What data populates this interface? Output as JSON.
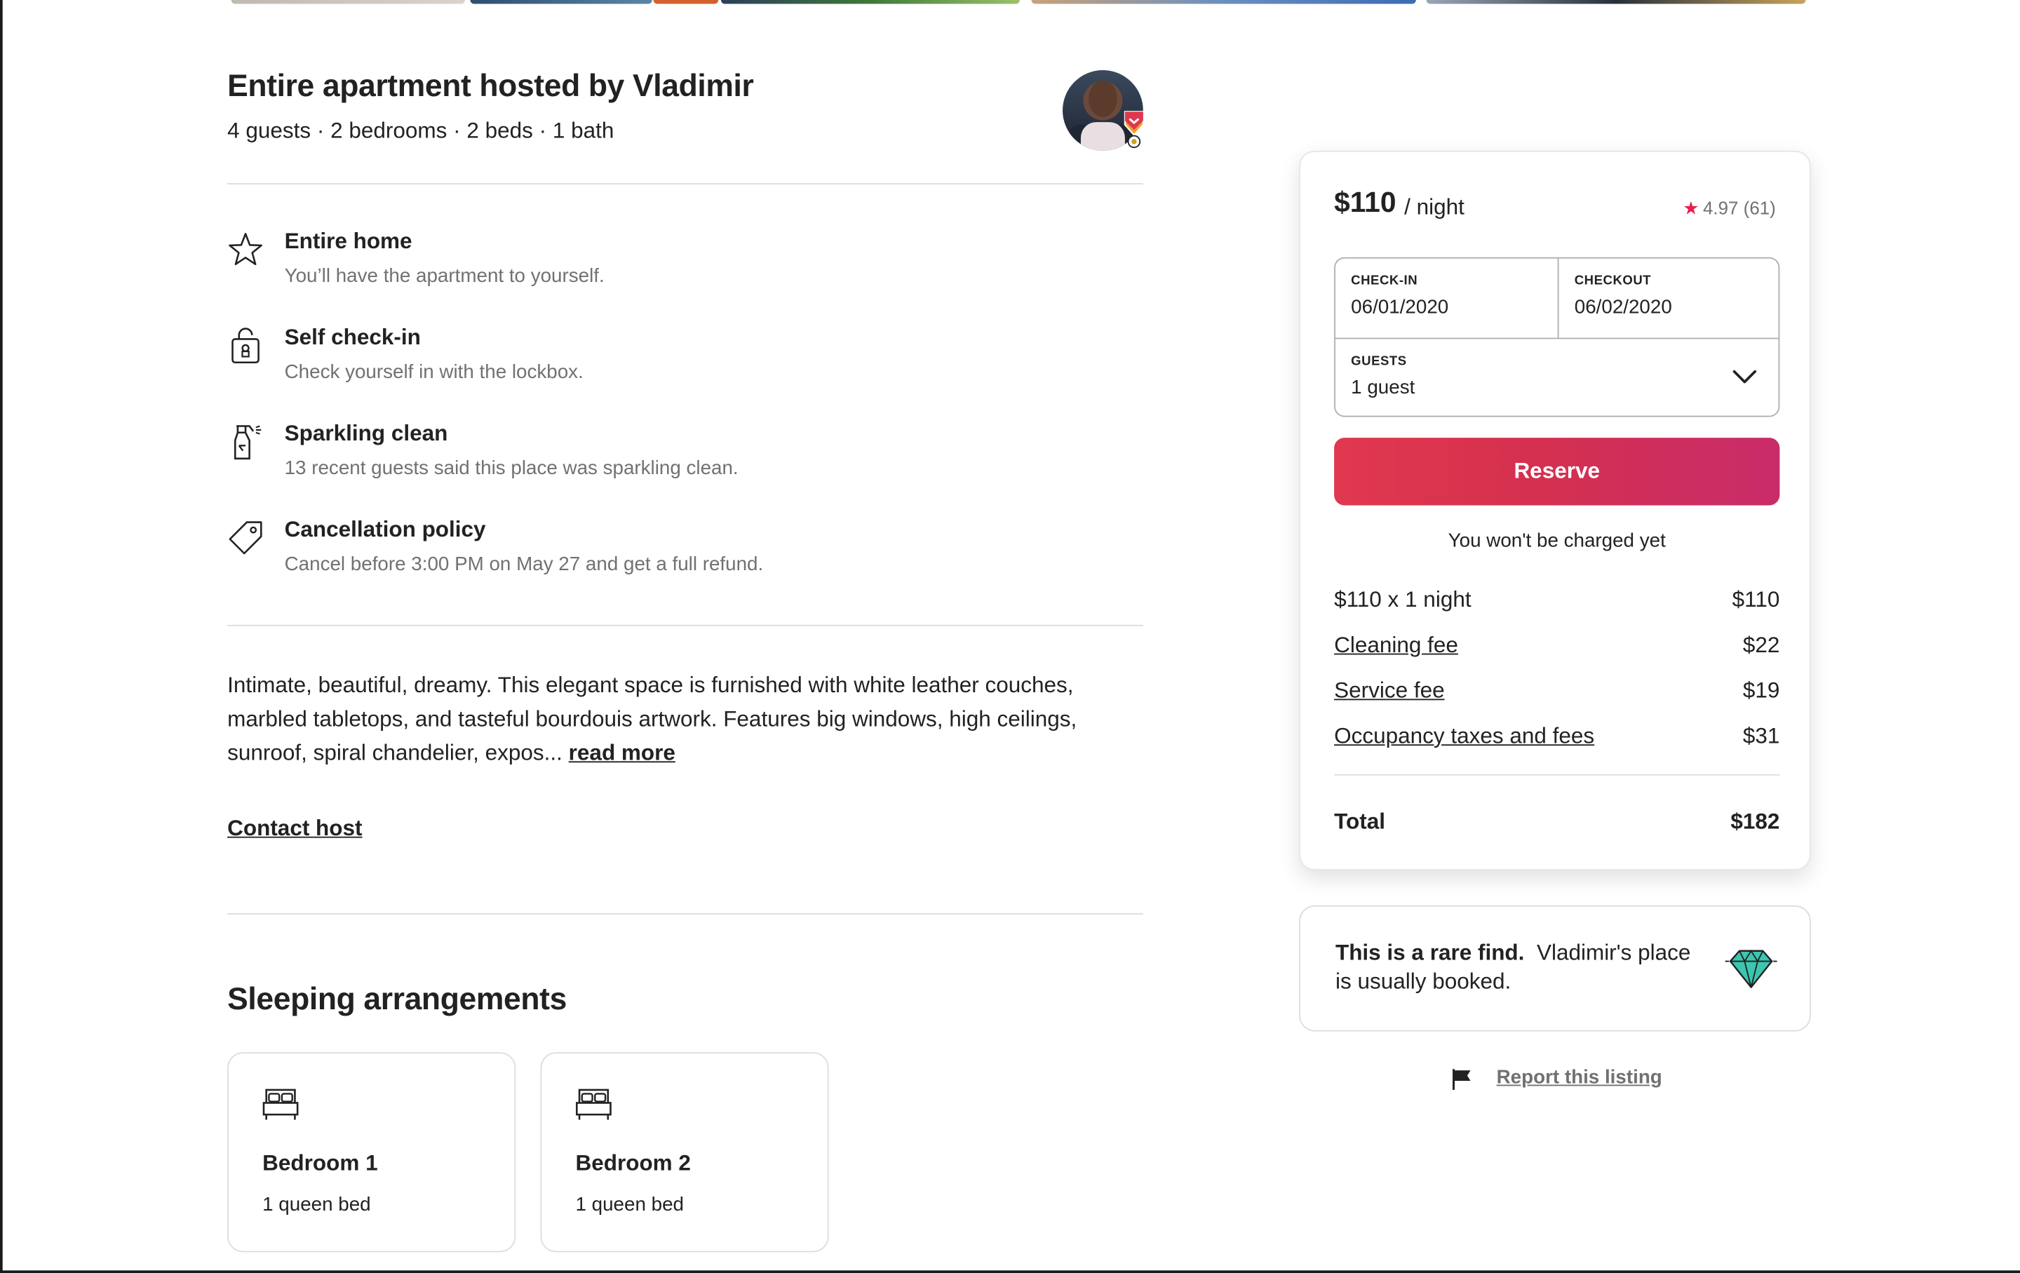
{
  "listing": {
    "title": "Entire apartment hosted by Vladimir",
    "summary": "4 guests · 2 bedrooms · 2 beds · 1 bath"
  },
  "highlights": [
    {
      "title": "Entire home",
      "subtitle": "You’ll have the apartment to yourself.",
      "icon": "star-icon"
    },
    {
      "title": "Self check-in",
      "subtitle": "Check yourself in with the lockbox.",
      "icon": "lockbox-icon"
    },
    {
      "title": "Sparkling clean",
      "subtitle": "13 recent guests said this place was sparkling clean.",
      "icon": "spray-bottle-icon"
    },
    {
      "title": "Cancellation policy",
      "subtitle": "Cancel before 3:00 PM on May 27 and get a full refund.",
      "icon": "tag-icon"
    }
  ],
  "description": {
    "text": "Intimate, beautiful, dreamy. This elegant space is furnished with white leather couches, marbled tabletops, and tasteful bourdouis artwork. Features big windows, high ceilings, sunroof, spiral chandelier, expos... ",
    "read_more": "read more"
  },
  "contact_host": "Contact host",
  "sleeping": {
    "title": "Sleeping arrangements",
    "rooms": [
      {
        "name": "Bedroom 1",
        "beds": "1 queen bed"
      },
      {
        "name": "Bedroom 2",
        "beds": "1 queen bed"
      }
    ]
  },
  "booking": {
    "price": "$110",
    "per_night": "/ night",
    "rating": "4.97 (61)",
    "checkin_label": "CHECK-IN",
    "checkin_value": "06/01/2020",
    "checkout_label": "CHECKOUT",
    "checkout_value": "06/02/2020",
    "guests_label": "GUESTS",
    "guests_value": "1 guest",
    "reserve_label": "Reserve",
    "no_charge": "You won't be charged yet",
    "line_items": [
      {
        "label": "$110 x 1 night",
        "amount": "$110"
      },
      {
        "label": "Cleaning fee",
        "amount": "$22"
      },
      {
        "label": "Service fee",
        "amount": "$19"
      },
      {
        "label": "Occupancy taxes and fees",
        "amount": "$31"
      }
    ],
    "total_label": "Total",
    "total_amount": "$182"
  },
  "rare_find": {
    "bold": "This is a rare find.",
    "text": "Vladimir's place is usually booked."
  },
  "report": {
    "label": "Report this listing"
  },
  "colors": {
    "brand": "#e61e4d",
    "reserve_gradient_start": "#e0384f",
    "reserve_gradient_end": "#c82c6a",
    "gem": "#3cc6b0"
  }
}
